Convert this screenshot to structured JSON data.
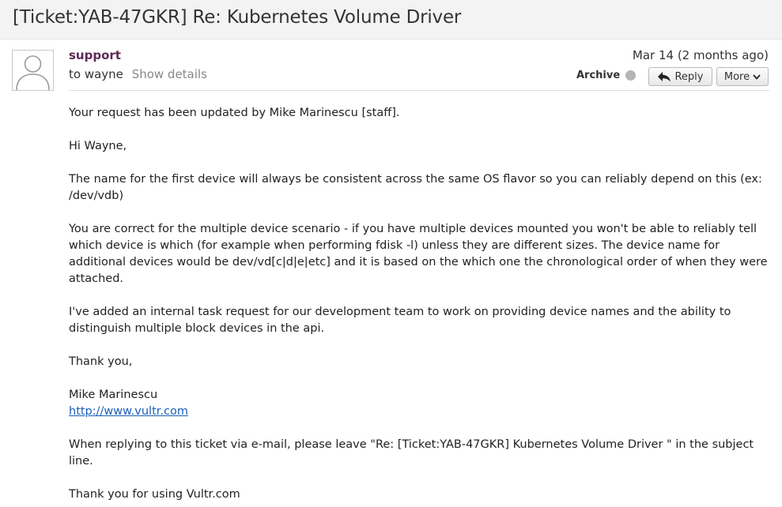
{
  "message": {
    "subject": "[Ticket:YAB-47GKR] Re: Kubernetes Volume Driver",
    "sender": "support",
    "recipient": "to wayne",
    "show_details": "Show details",
    "date": "Mar 14 (2 months ago)",
    "actions": {
      "archive": "Archive",
      "reply": "Reply",
      "more": "More"
    },
    "body": {
      "intro": "Your request has been updated by Mike Marinescu [staff].",
      "greeting": "Hi Wayne,",
      "para1": "The name for the first device will always be consistent across the same OS flavor so you can reliably depend on this (ex: /dev/vdb)",
      "para2": "You are correct for the multiple device scenario - if you have multiple devices mounted you won't be able to reliably tell which device is which (for example when performing fdisk -l) unless they are different sizes. The device name for additional devices would be dev/vd[c|d|e|etc] and it is based on the which one the chronological order of when they were attached.",
      "para3": "I've added an internal task request for our development team to work on providing device names and the ability to distinguish multiple block devices in the api.",
      "thanks": "Thank you,",
      "signature_name": "Mike Marinescu",
      "signature_link": "http://www.vultr.com",
      "reply_note": "When replying to this ticket via e-mail, please leave \"Re: [Ticket:YAB-47GKR] Kubernetes Volume Driver \" in the subject line.",
      "closing": "Thank you for using Vultr.com"
    }
  },
  "icons": {
    "avatar": "default-person-icon",
    "reply": "reply-arrow-icon",
    "more": "chevron-down-icon"
  },
  "colors": {
    "sender": "#5d2a54",
    "link": "#1a5eb8",
    "status_dot": "#b5b5b5",
    "muted": "#888888"
  }
}
